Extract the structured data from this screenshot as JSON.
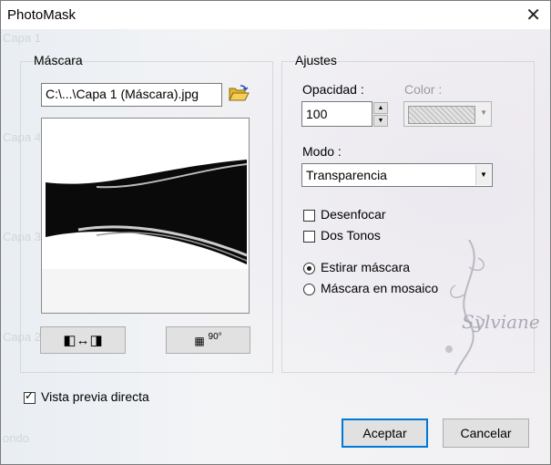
{
  "window": {
    "title": "PhotoMask"
  },
  "background_ghost_labels": [
    "Capa 1",
    "Capa 4",
    "Capa 3",
    "Capa 2",
    "ondo"
  ],
  "mask_group": {
    "label": "Máscara",
    "file_path": "C:\\...\\Capa 1 (Máscara).jpg"
  },
  "settings_group": {
    "label": "Ajustes",
    "opacity_label": "Opacidad :",
    "opacity_value": "100",
    "color_label": "Color :",
    "mode_label": "Modo :",
    "mode_value": "Transparencia",
    "blur_label": "Desenfocar",
    "blur_checked": false,
    "two_tones_label": "Dos Tonos",
    "two_tones_checked": false,
    "stretch_label": "Estirar máscara",
    "stretch_selected": true,
    "tile_label": "Máscara en mosaico",
    "tile_selected": false
  },
  "rotate_button_text": "90°",
  "watermark_text": "Sylviane",
  "live_preview": {
    "label": "Vista previa directa",
    "checked": true
  },
  "buttons": {
    "accept": "Aceptar",
    "cancel": "Cancelar"
  }
}
